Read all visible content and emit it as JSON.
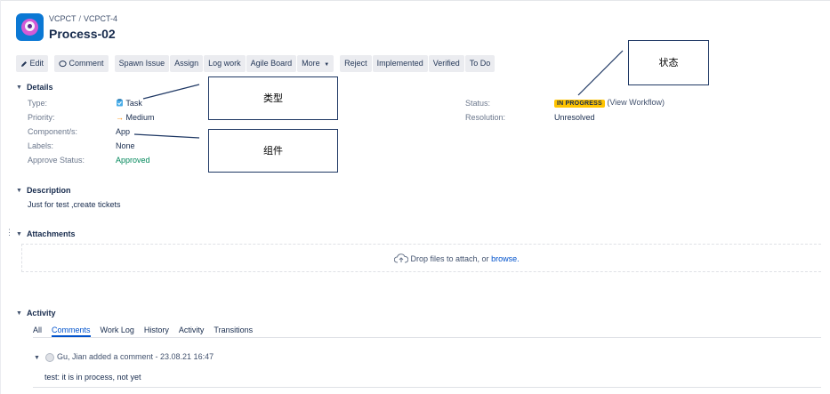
{
  "header": {
    "project": "VCPCT",
    "issue_key": "VCPCT-4",
    "title": "Process-02"
  },
  "toolbar": {
    "edit": "Edit",
    "comment": "Comment",
    "spawn_issue": "Spawn Issue",
    "assign": "Assign",
    "log_work": "Log work",
    "agile_board": "Agile Board",
    "more": "More",
    "reject": "Reject",
    "implemented": "Implemented",
    "verified": "Verified",
    "to_do": "To Do"
  },
  "details": {
    "section_title": "Details",
    "type_label": "Type:",
    "type_value": "Task",
    "priority_label": "Priority:",
    "priority_value": "Medium",
    "components_label": "Component/s:",
    "components_value": "App",
    "labels_label": "Labels:",
    "labels_value": "None",
    "approve_label": "Approve Status:",
    "approve_value": "Approved",
    "status_label": "Status:",
    "status_value": "IN PROGRESS",
    "view_workflow": "(View Workflow)",
    "resolution_label": "Resolution:",
    "resolution_value": "Unresolved"
  },
  "callouts": {
    "type": "类型",
    "component": "组件",
    "status": "状态"
  },
  "description": {
    "section_title": "Description",
    "text": "Just for test ,create tickets"
  },
  "attachments": {
    "section_title": "Attachments",
    "drop_text": "Drop files to attach, or",
    "browse": "browse."
  },
  "activity": {
    "section_title": "Activity",
    "tabs": [
      "All",
      "Comments",
      "Work Log",
      "History",
      "Activity",
      "Transitions"
    ],
    "active_tab": "Comments",
    "comment_header": "Gu, Jian added a comment - 23.08.21 16:47",
    "comment_text": "test: it is in process, not yet"
  },
  "colors": {
    "status_badge": "#ffc400",
    "approved": "#00875a",
    "link": "#0052cc",
    "priority_arrow": "#ff8b00"
  }
}
